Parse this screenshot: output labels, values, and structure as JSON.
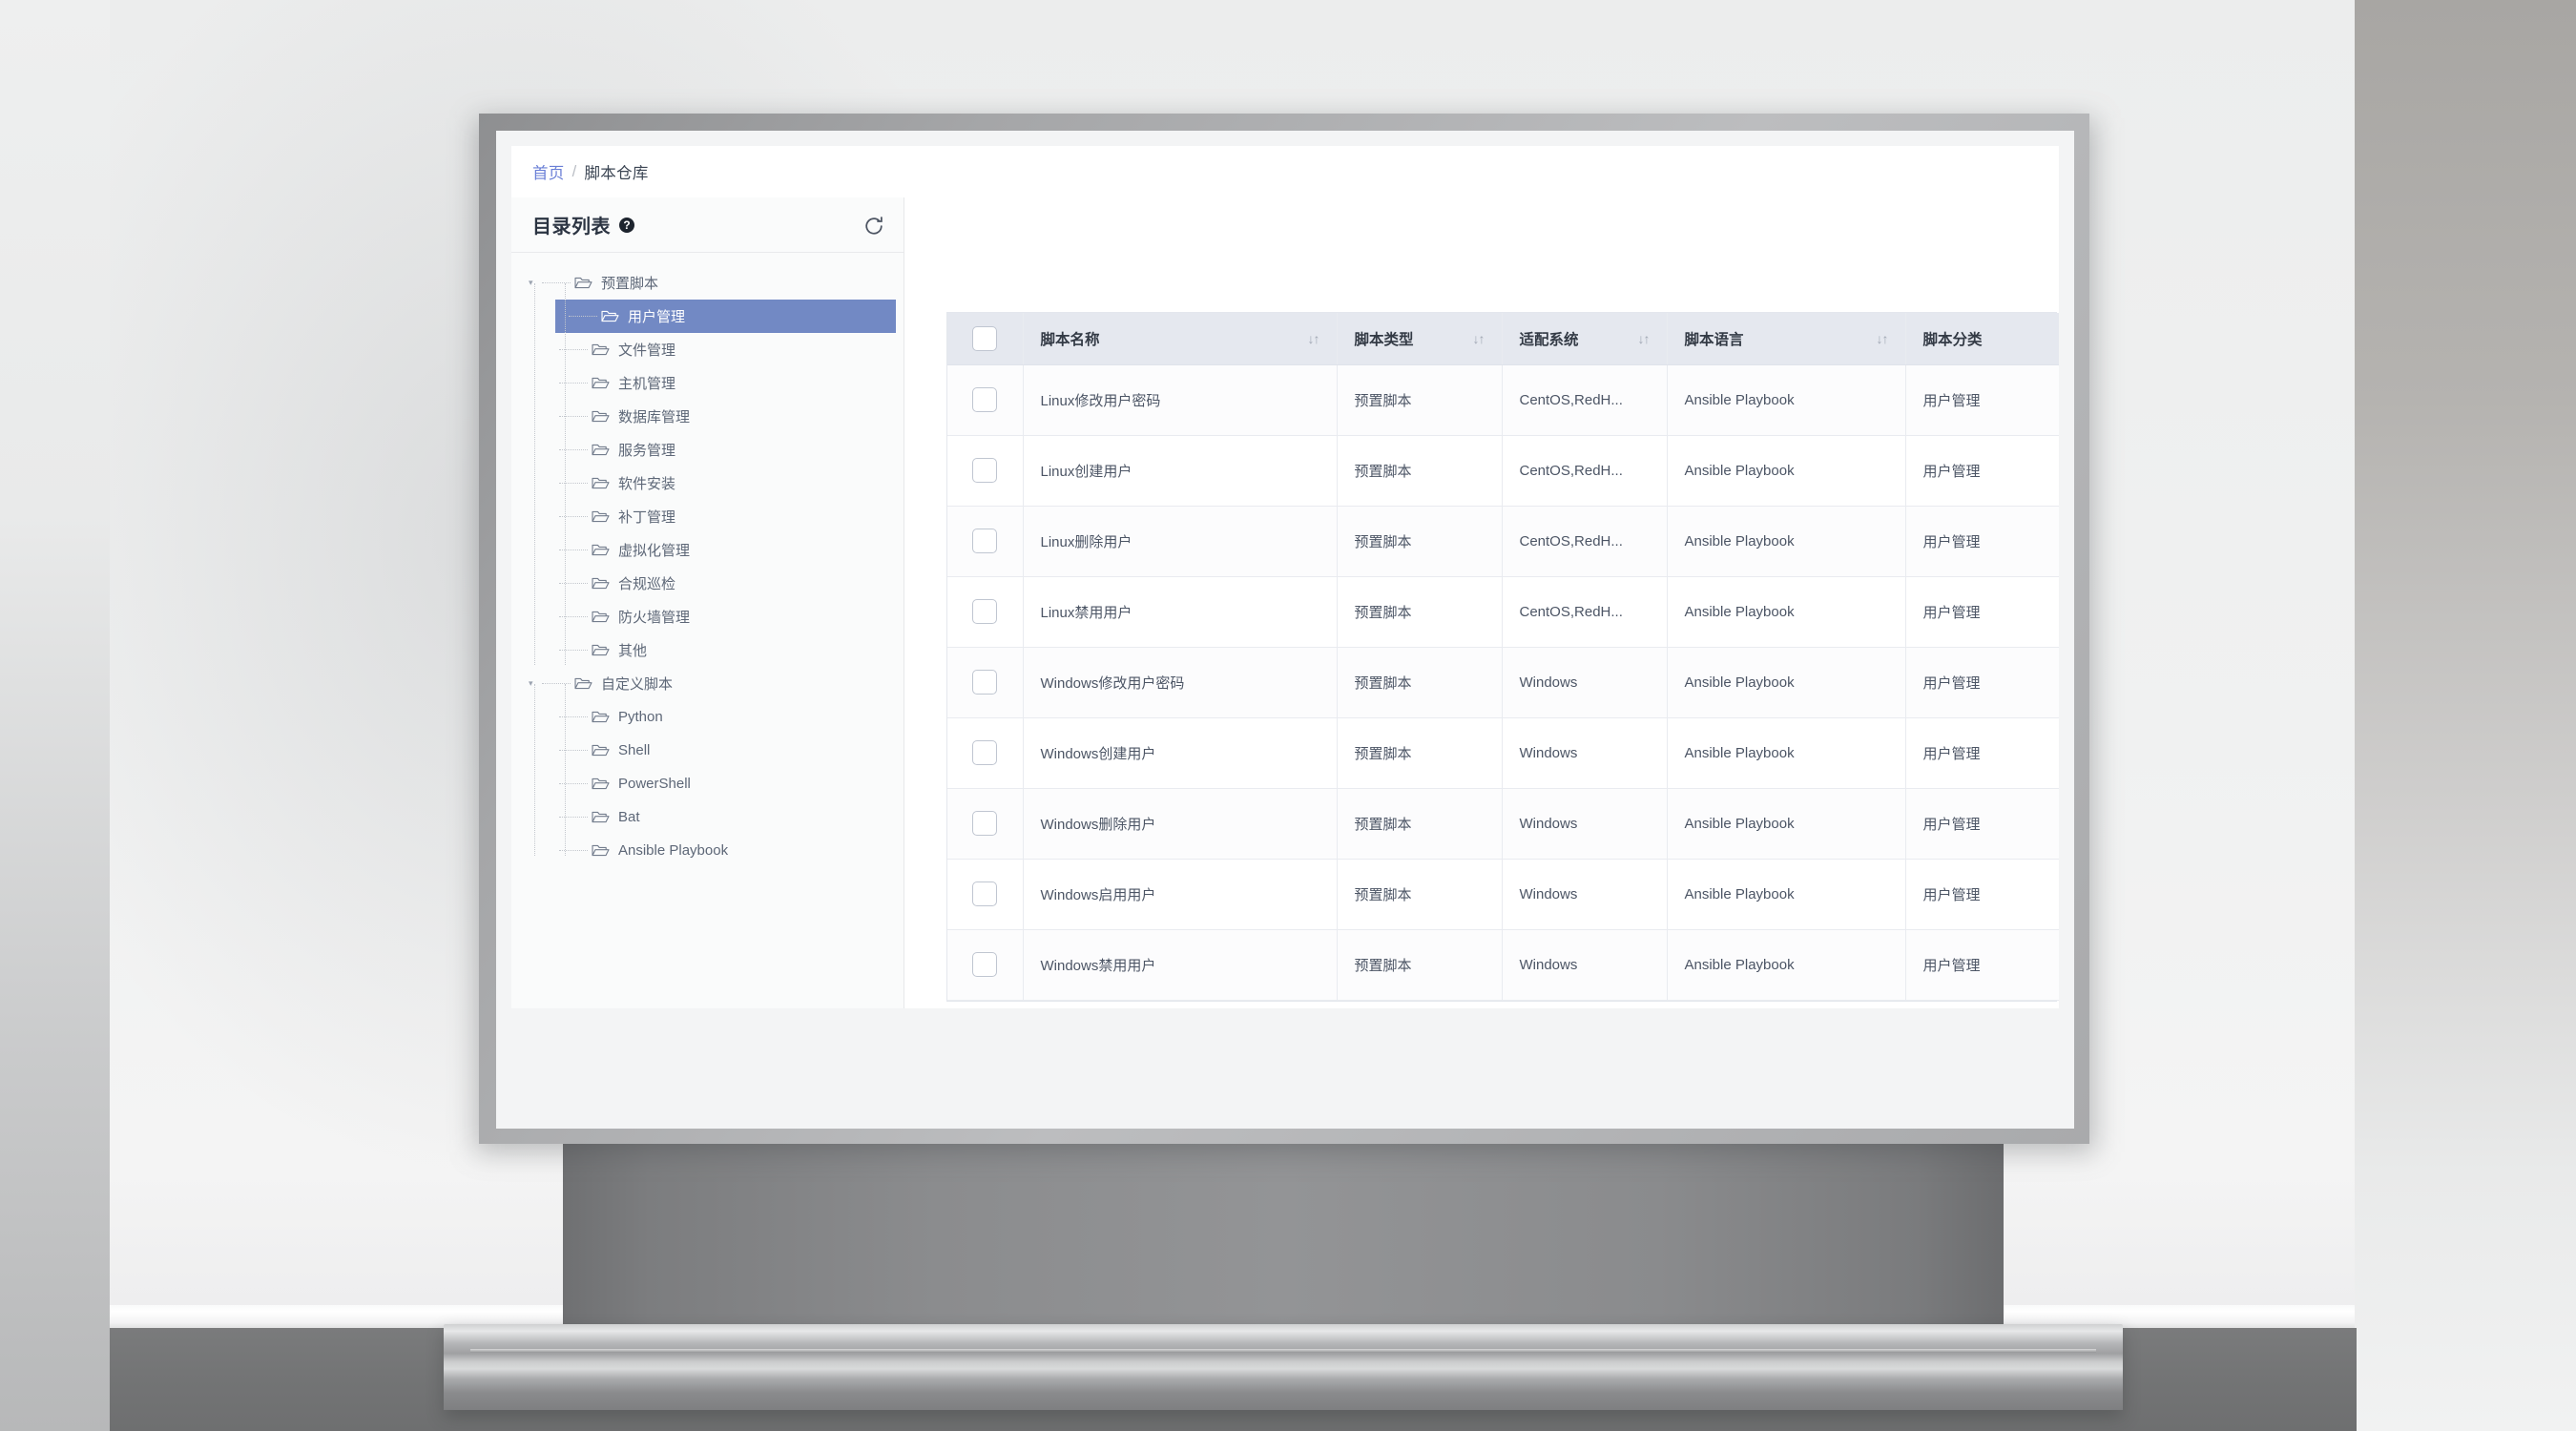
{
  "breadcrumb": {
    "home": "首页",
    "separator": "/",
    "current": "脚本仓库"
  },
  "sidebar": {
    "title": "目录列表",
    "help_icon": "question-mark-icon",
    "refresh_icon": "refresh-icon",
    "tree": [
      {
        "label": "预置脚本",
        "level": 1,
        "expanded": true,
        "selected": false
      },
      {
        "label": "用户管理",
        "level": 2,
        "expanded": false,
        "selected": true
      },
      {
        "label": "文件管理",
        "level": 2,
        "expanded": false,
        "selected": false
      },
      {
        "label": "主机管理",
        "level": 2,
        "expanded": false,
        "selected": false
      },
      {
        "label": "数据库管理",
        "level": 2,
        "expanded": false,
        "selected": false
      },
      {
        "label": "服务管理",
        "level": 2,
        "expanded": false,
        "selected": false
      },
      {
        "label": "软件安装",
        "level": 2,
        "expanded": false,
        "selected": false
      },
      {
        "label": "补丁管理",
        "level": 2,
        "expanded": false,
        "selected": false
      },
      {
        "label": "虚拟化管理",
        "level": 2,
        "expanded": false,
        "selected": false
      },
      {
        "label": "合规巡检",
        "level": 2,
        "expanded": false,
        "selected": false
      },
      {
        "label": "防火墙管理",
        "level": 2,
        "expanded": false,
        "selected": false
      },
      {
        "label": "其他",
        "level": 2,
        "expanded": false,
        "selected": false
      },
      {
        "label": "自定义脚本",
        "level": 1,
        "expanded": true,
        "selected": false
      },
      {
        "label": "Python",
        "level": 2,
        "expanded": false,
        "selected": false
      },
      {
        "label": "Shell",
        "level": 2,
        "expanded": false,
        "selected": false
      },
      {
        "label": "PowerShell",
        "level": 2,
        "expanded": false,
        "selected": false
      },
      {
        "label": "Bat",
        "level": 2,
        "expanded": false,
        "selected": false
      },
      {
        "label": "Ansible Playbook",
        "level": 2,
        "expanded": false,
        "selected": false
      }
    ]
  },
  "table": {
    "select_all_checked": false,
    "sort_icon": "↓↑",
    "columns": [
      {
        "key": "checkbox",
        "label": "",
        "sortable": false
      },
      {
        "key": "name",
        "label": "脚本名称",
        "sortable": true
      },
      {
        "key": "type",
        "label": "脚本类型",
        "sortable": true
      },
      {
        "key": "os",
        "label": "适配系统",
        "sortable": true
      },
      {
        "key": "lang",
        "label": "脚本语言",
        "sortable": true
      },
      {
        "key": "category",
        "label": "脚本分类",
        "sortable": true
      }
    ],
    "rows": [
      {
        "name": "Linux修改用户密码",
        "type": "预置脚本",
        "os": "CentOS,RedH...",
        "lang": "Ansible Playbook",
        "category": "用户管理",
        "checked": false
      },
      {
        "name": "Linux创建用户",
        "type": "预置脚本",
        "os": "CentOS,RedH...",
        "lang": "Ansible Playbook",
        "category": "用户管理",
        "checked": false
      },
      {
        "name": "Linux删除用户",
        "type": "预置脚本",
        "os": "CentOS,RedH...",
        "lang": "Ansible Playbook",
        "category": "用户管理",
        "checked": false
      },
      {
        "name": "Linux禁用用户",
        "type": "预置脚本",
        "os": "CentOS,RedH...",
        "lang": "Ansible Playbook",
        "category": "用户管理",
        "checked": false
      },
      {
        "name": "Windows修改用户密码",
        "type": "预置脚本",
        "os": "Windows",
        "lang": "Ansible Playbook",
        "category": "用户管理",
        "checked": false
      },
      {
        "name": "Windows创建用户",
        "type": "预置脚本",
        "os": "Windows",
        "lang": "Ansible Playbook",
        "category": "用户管理",
        "checked": false
      },
      {
        "name": "Windows删除用户",
        "type": "预置脚本",
        "os": "Windows",
        "lang": "Ansible Playbook",
        "category": "用户管理",
        "checked": false
      },
      {
        "name": "Windows启用用户",
        "type": "预置脚本",
        "os": "Windows",
        "lang": "Ansible Playbook",
        "category": "用户管理",
        "checked": false
      },
      {
        "name": "Windows禁用用户",
        "type": "预置脚本",
        "os": "Windows",
        "lang": "Ansible Playbook",
        "category": "用户管理",
        "checked": false
      }
    ]
  },
  "colors": {
    "breadcrumb_link": "#6a7fd6",
    "tree_selected_bg": "#7289c4",
    "table_header_bg": "#e5e8ef",
    "text_primary": "#3c4654",
    "text_secondary": "#5d6777"
  }
}
